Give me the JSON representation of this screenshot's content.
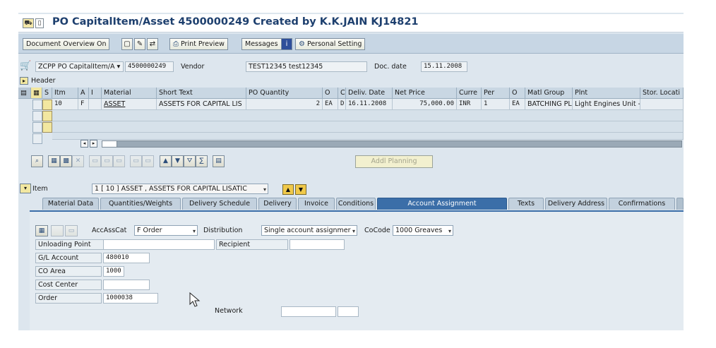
{
  "title": "PO CapitalItem/Asset 4500000249 Created by K.K.JAIN KJ14821",
  "toolbar": {
    "doc_overview": "Document Overview On",
    "print_preview": "Print Preview",
    "messages": "Messages",
    "personal_setting": "Personal Setting"
  },
  "header_row": {
    "doc_type": "ZCPP PO CapitalItem/A",
    "po_number": "4500000249",
    "vendor_label": "Vendor",
    "vendor_value": "TEST12345 test12345",
    "doc_date_label": "Doc. date",
    "doc_date_value": "15.11.2008"
  },
  "header_label": "Header",
  "grid": {
    "columns": [
      "S",
      "Itm",
      "A",
      "I",
      "Material",
      "Short Text",
      "PO Quantity",
      "O",
      "C",
      "Deliv. Date",
      "Net Price",
      "Curre",
      "Per",
      "O",
      "Matl Group",
      "Plnt",
      "Stor. Locati"
    ],
    "row": {
      "itm": "10",
      "a": "F",
      "material": "ASSET",
      "short_text": "ASSETS FOR CAPITAL LIS",
      "po_quantity": "2",
      "oun": "EA",
      "c": "D",
      "deliv_date": "16.11.2008",
      "net_price": "75,000.00",
      "currency": "INR",
      "per": "1",
      "opu": "EA",
      "matl_group": "BATCHING PL",
      "plant": "Light Engines Unit -"
    }
  },
  "addl_planning": "Addl Planning",
  "item": {
    "label": "Item",
    "value": "1 [ 10 ] ASSET , ASSETS FOR CAPITAL LISATIC"
  },
  "tabs": [
    "Material Data",
    "Quantities/Weights",
    "Delivery Schedule",
    "Delivery",
    "Invoice",
    "Conditions",
    "Account Assignment",
    "Texts",
    "Delivery Address",
    "Confirmations"
  ],
  "account_assignment": {
    "accasscat_label": "AccAssCat",
    "accasscat_value": "F Order",
    "distribution_label": "Distribution",
    "distribution_value": "Single account assignmer",
    "cocode_label": "CoCode",
    "cocode_value": "1000 Greaves",
    "unloading_point_label": "Unloading Point",
    "unloading_point_value": "",
    "recipient_label": "Recipient",
    "recipient_value": "",
    "gl_account_label": "G/L Account",
    "gl_account_value": "480010",
    "co_area_label": "CO Area",
    "co_area_value": "1000",
    "cost_center_label": "Cost Center",
    "cost_center_value": "",
    "order_label": "Order",
    "order_value": "1000038",
    "network_label": "Network",
    "network_value": ""
  }
}
